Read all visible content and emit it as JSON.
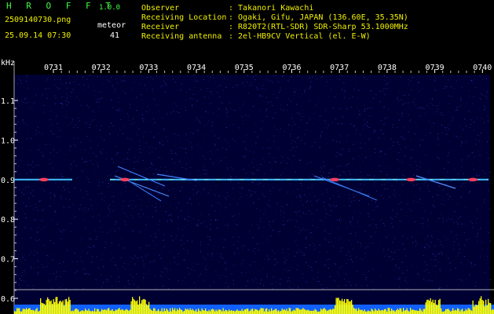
{
  "app": {
    "name": "H R O F F T",
    "version": "1.0.0",
    "filename": "2509140730.png",
    "datetime": "25.09.14 07:30",
    "count_label": "meteor",
    "count_value": "41"
  },
  "info": {
    "labels": [
      "Observer",
      "Receiving Location",
      "Receiver",
      "Receiving antenna"
    ],
    "values": [
      ": Takanori Kawachi",
      ": Ogaki, Gifu, JAPAN (136.60E, 35.35N)",
      ": R820T2(RTL-SDR) SDR-Sharp 53.1000MHz",
      ": 2el-HB9CV Vertical (el. E-W)"
    ]
  },
  "chart_data": {
    "type": "heatmap",
    "ylabel": "kHz",
    "x_ticks": [
      "0731",
      "0732",
      "0733",
      "0734",
      "0735",
      "0736",
      "0737",
      "0738",
      "0739",
      "0740"
    ],
    "y_ticks": [
      "1.1",
      "1.0",
      "0.9",
      "0.8",
      "0.7",
      "0.6"
    ],
    "ylim": [
      0.58,
      1.16
    ],
    "carrier_khz": 0.9,
    "meteors": [
      {
        "time": "07:30.8",
        "freq_khz": 0.9
      },
      {
        "time": "07:32.5",
        "freq_khz": 0.9
      },
      {
        "time": "07:36.9",
        "freq_khz": 0.9
      },
      {
        "time": "07:38.5",
        "freq_khz": 0.9
      },
      {
        "time": "07:39.8",
        "freq_khz": 0.9
      }
    ],
    "colors": {
      "background": "#000033",
      "carrier": "#40c0ff",
      "bars": "#ffff00",
      "bar_base": "#1060ff"
    }
  }
}
